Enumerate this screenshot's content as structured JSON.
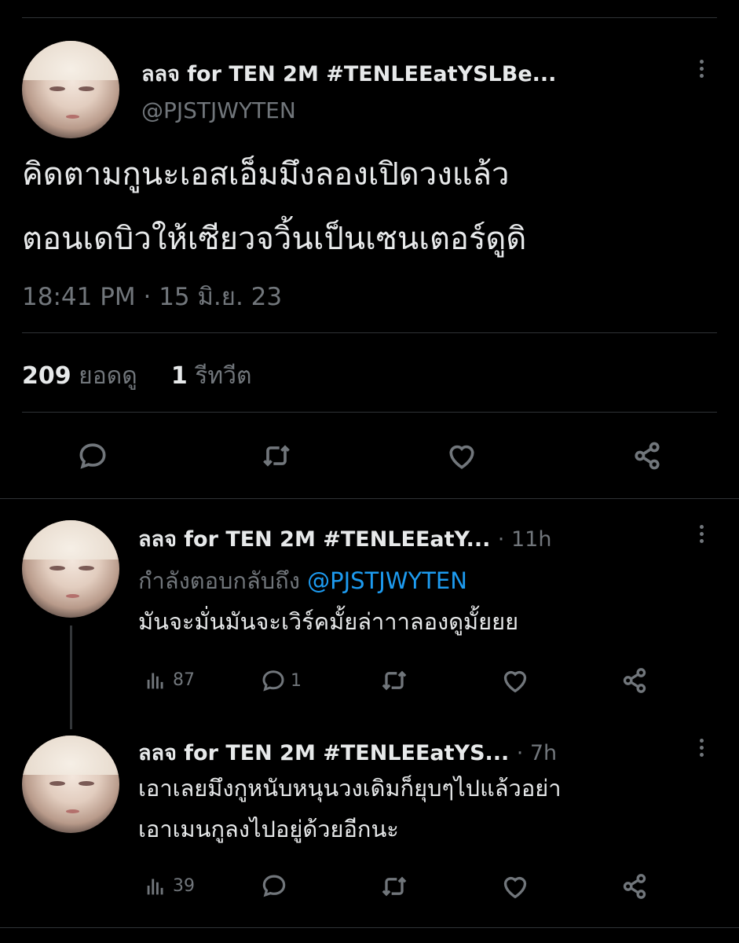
{
  "main_tweet": {
    "author_name": "ลลจ for TEN 2M #TENLEEatYSLBe...",
    "handle": "@PJSTJWYTEN",
    "text_line1": "คิดตามกูนะเอสเอ็มมึงลองเปิดวงแล้ว",
    "text_line2": "ตอนเดบิวให้เซียวจวิ้นเป็นเซนเตอร์ดูดิ",
    "timestamp": "18:41 PM · 15 มิ.ย. 23",
    "views_count": "209",
    "views_label": "ยอดดู",
    "retweets_count": "1",
    "retweets_label": "รีทวีต"
  },
  "replies": [
    {
      "author_name": "ลลจ for TEN 2M #TENLEEatY...",
      "time": "· 11h",
      "replying_label": "กำลังตอบกลับถึง",
      "replying_to": "@PJSTJWYTEN",
      "text_line1": "มันจะมั่นมันจะเวิร์คมั้ยล่าาาลองดูมั้ยยย",
      "views": "87",
      "replies": "1"
    },
    {
      "author_name": "ลลจ for TEN 2M #TENLEEatYS...",
      "time": "· 7h",
      "text_line1": "เอาเลยมึงกูหนับหนุนวงเดิมก็ยุบๆไปแล้วอย่า",
      "text_line2": "เอาเมนกูลงไปอยู่ด้วยอีกนะ",
      "views": "39"
    }
  ],
  "icons": {
    "reply": "reply-icon",
    "retweet": "retweet-icon",
    "like": "heart-icon",
    "share": "share-icon",
    "views": "analytics-icon",
    "more": "more-icon"
  },
  "colors": {
    "background": "#000000",
    "text": "#e7e9ea",
    "muted": "#71767b",
    "mention": "#1d9bf0",
    "divider": "#2f3336"
  }
}
